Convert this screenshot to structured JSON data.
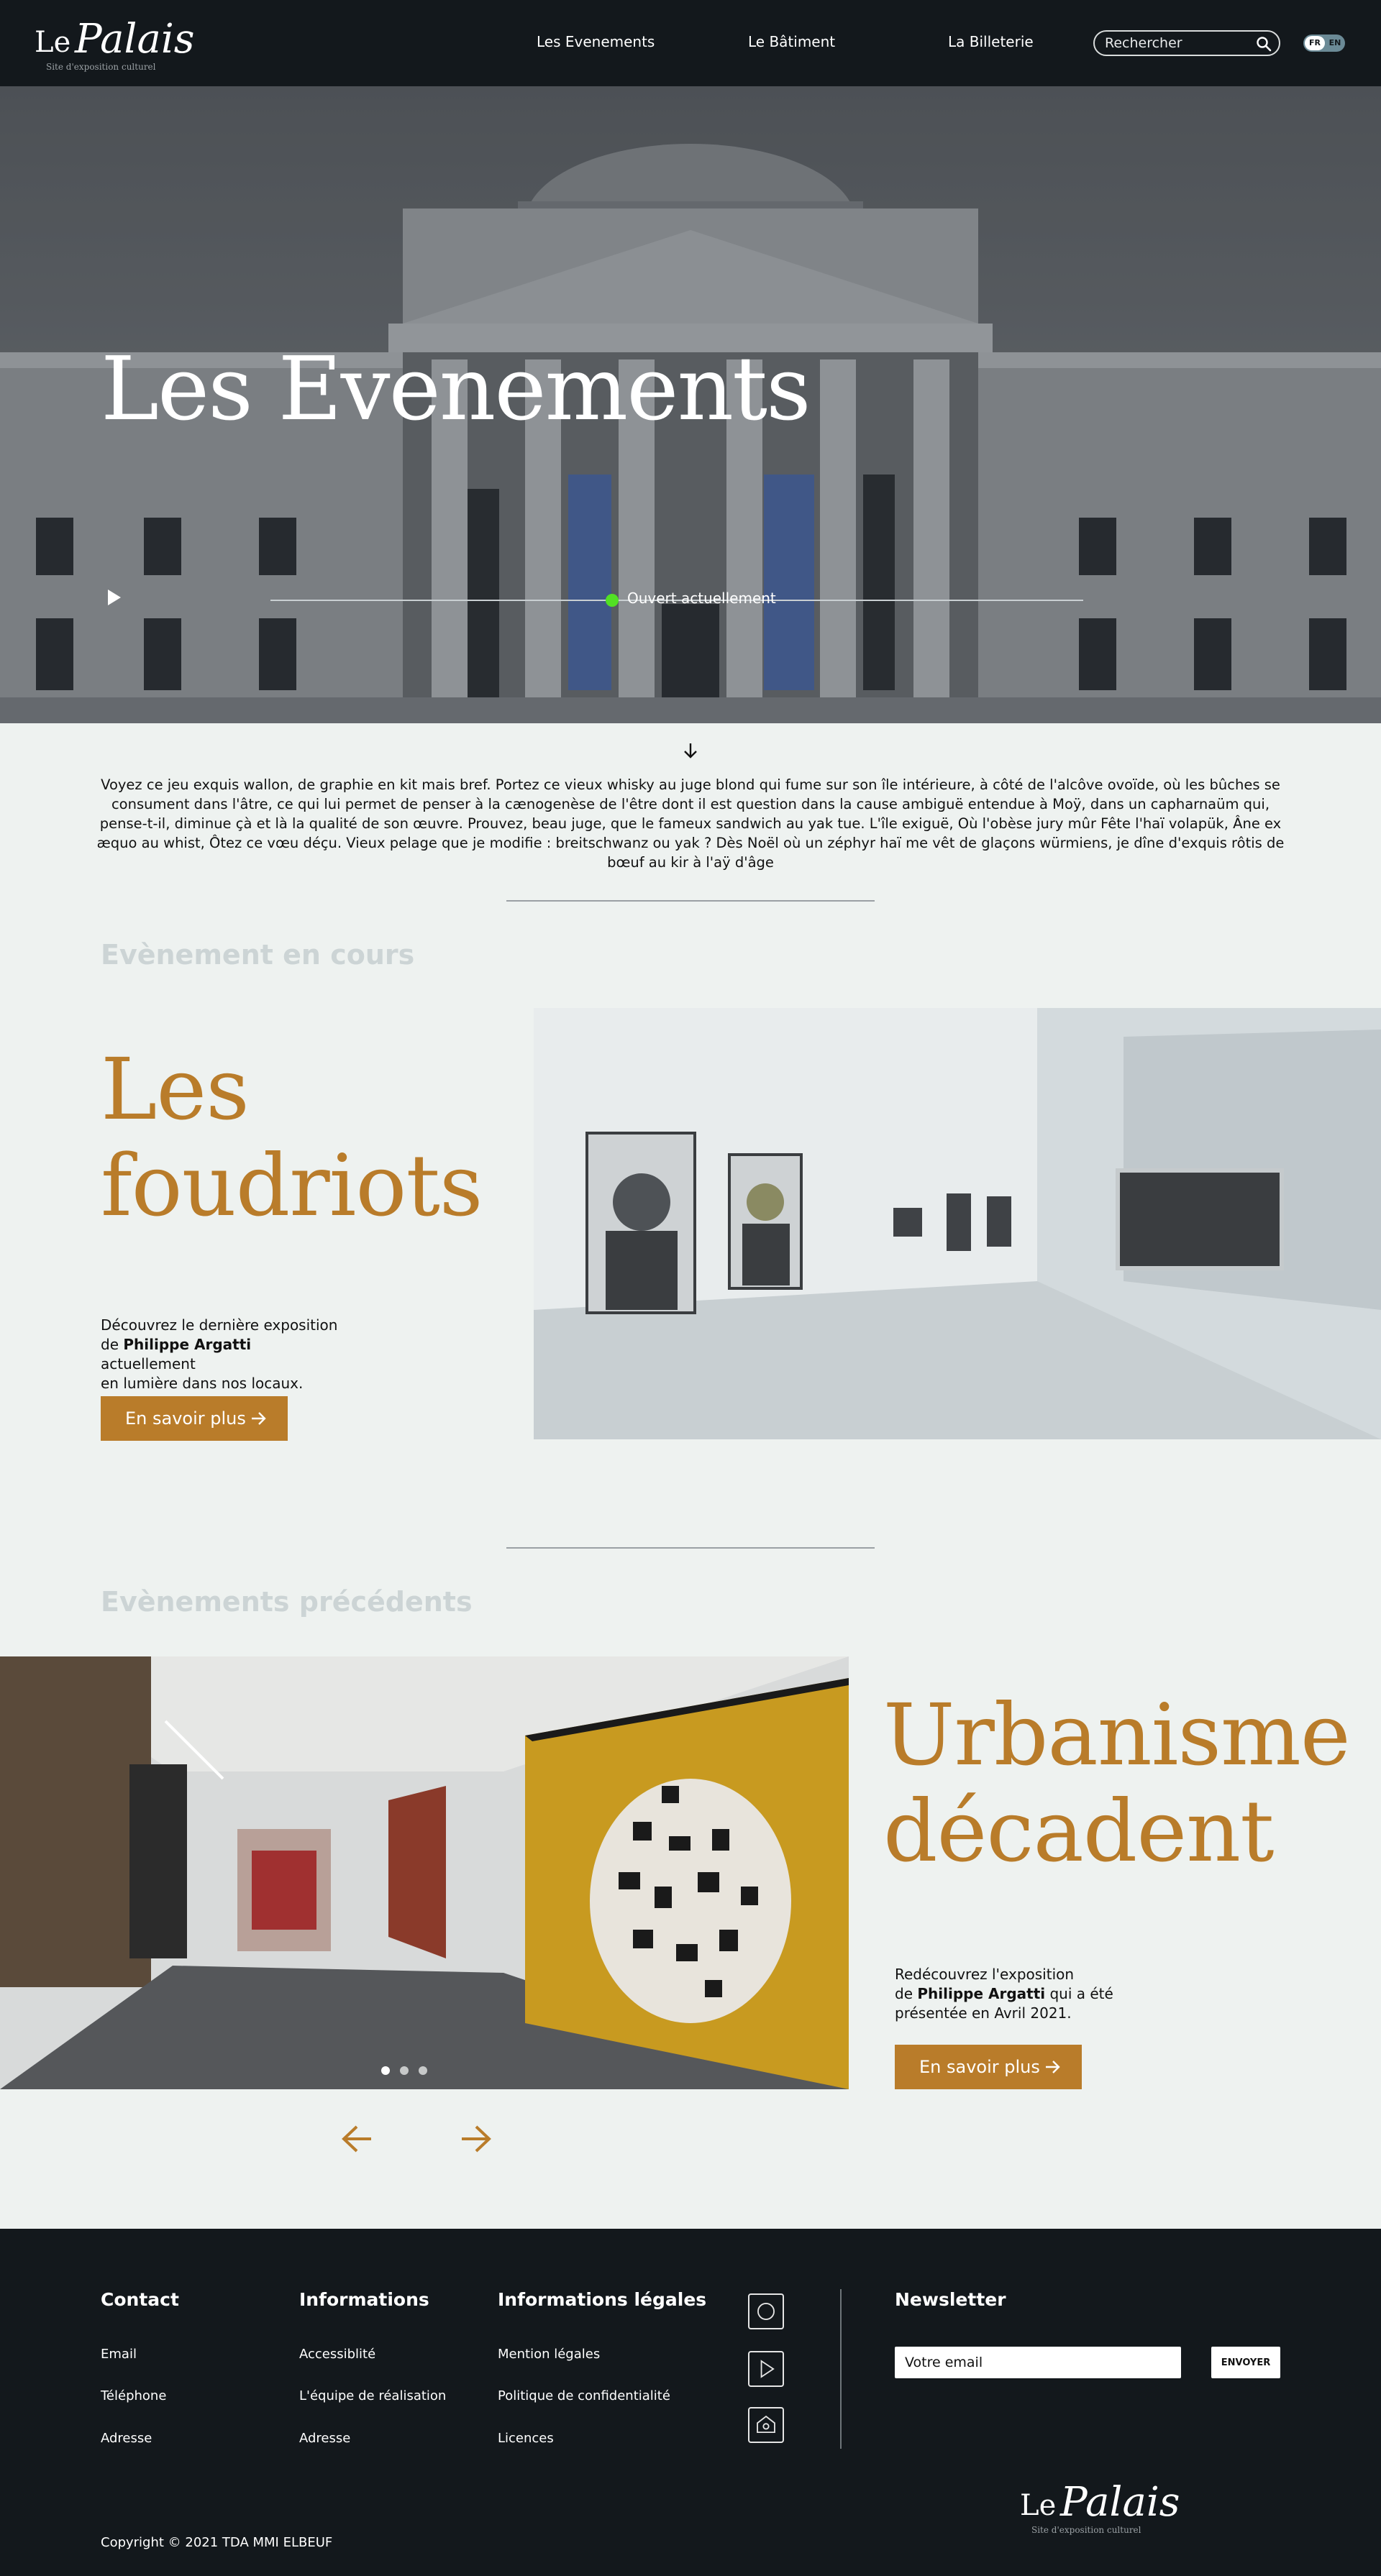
{
  "nav": {
    "logo_le": "Le",
    "logo_palais": "Palais",
    "logo_tagline": "Site d'exposition culturel",
    "links": [
      "Les Evenements",
      "Le Bâtiment",
      "La Billeterie"
    ],
    "search_placeholder": "Rechercher",
    "lang_fr": "FR",
    "lang_en": "EN"
  },
  "hero": {
    "title": "Les Evenements",
    "status": "Ouvert actuellement",
    "progress_fraction": 0.42
  },
  "intro": {
    "text": "Voyez ce jeu exquis wallon, de graphie en kit mais bref. Portez ce vieux whisky au juge blond qui fume sur son île intérieure, à côté de l'alcôve ovoïde, où les bûches se consument dans l'âtre, ce qui lui permet de penser à la cænogenèse de l'être dont il est question dans la cause ambiguë entendue à Moÿ, dans un capharnaüm qui, pense-t-il, diminue çà et là la qualité de son œuvre. Prouvez, beau juge, que le fameux sandwich au yak tue. L'île exiguë, Où l'obèse jury mûr Fête l'haï volapük, Âne ex æquo au whist, Ôtez ce vœu déçu. Vieux pelage que je modifie : breitschwanz ou yak ? Dès Noël où un zéphyr haï me vêt de glaçons würmiens, je dîne d'exquis rôtis de bœuf au kir à l'aÿ d'âge"
  },
  "current": {
    "label": "Evènement en cours",
    "title_line1": "Les",
    "title_line2": "foudriots",
    "desc_pre": "Découvrez le dernière exposition",
    "desc_de": "de ",
    "desc_artist": "Philippe Argatti",
    "desc_post": " actuellement",
    "desc_line3": "en lumière dans nos locaux.",
    "button": "En savoir plus"
  },
  "previous": {
    "label": "Evènements précédents",
    "title_line1": "Urbanisme",
    "title_line2": "décadent",
    "desc_line1": "Redécouvrez l'exposition",
    "desc_de": "de ",
    "desc_artist": "Philippe Argatti",
    "desc_post": " qui a été",
    "desc_line3": "présentée en Avril 2021.",
    "button": "En savoir plus"
  },
  "footer": {
    "contact": {
      "heading": "Contact",
      "items": [
        "Email",
        "Téléphone",
        "Adresse"
      ]
    },
    "info": {
      "heading": "Informations",
      "items": [
        "Accessiblité",
        "L'équipe de réalisation",
        "Adresse"
      ]
    },
    "legal": {
      "heading": "Informations légales",
      "items": [
        "Mention légales",
        "Politique de confidentialité",
        "Licences"
      ]
    },
    "newsletter": {
      "heading": "Newsletter",
      "placeholder": "Votre email",
      "button": "ENVOYER"
    },
    "copyright": "Copyright © 2021 TDA MMI ELBEUF",
    "logo_le": "Le",
    "logo_palais": "Palais",
    "logo_tagline": "Site d'exposition culturel"
  },
  "colors": {
    "accent": "#b97c2a",
    "dark": "#13181c",
    "background": "#eef2f0",
    "status_dot": "#52e024"
  }
}
